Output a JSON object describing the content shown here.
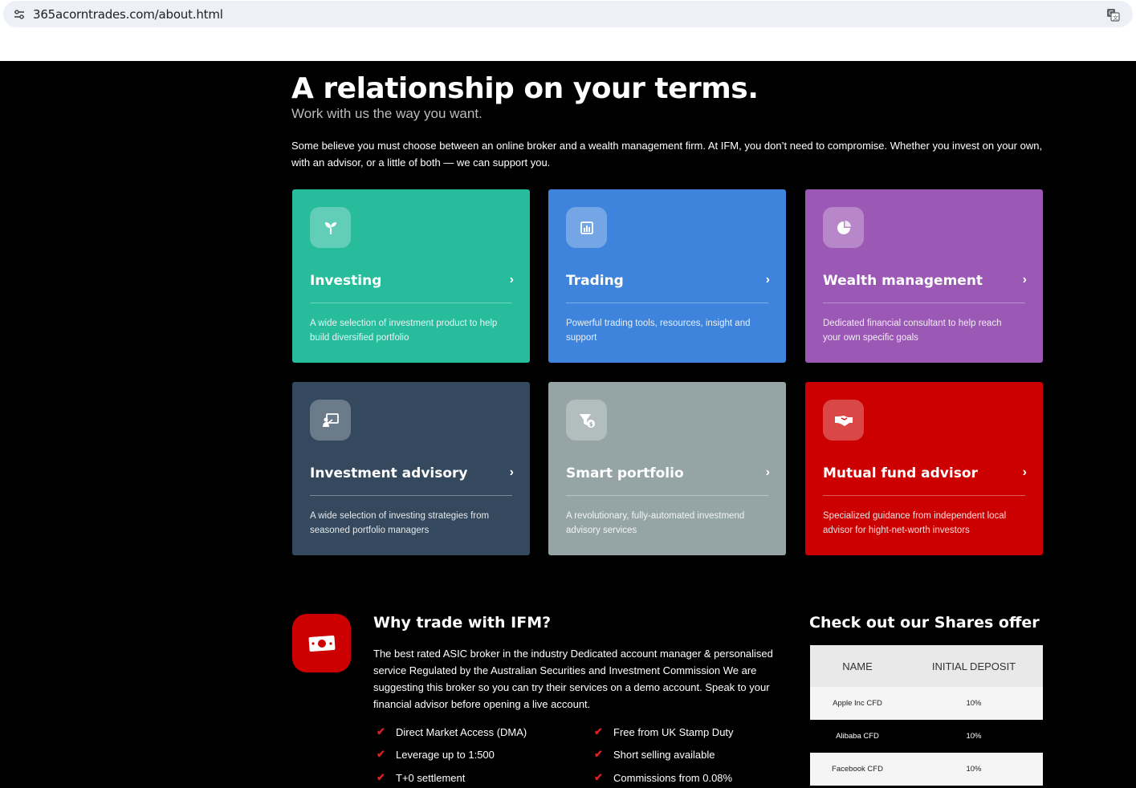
{
  "browser": {
    "url": "365acorntrades.com/about.html"
  },
  "hero": {
    "title_pre": "A",
    "title_highlight": "relationship",
    "title_post": "on your terms.",
    "subtitle": "Work with us the way you want.",
    "body": "Some believe you must choose between an online broker and a wealth management firm. At IFM, you don’t need to compromise. Whether you invest on your own, with an advisor, or a little of both — we can support you."
  },
  "cards": [
    {
      "title": "Investing",
      "desc": "A wide selection of investment product to help build diversified portfolio",
      "color": "#27bc9c",
      "icon": "sprout-icon"
    },
    {
      "title": "Trading",
      "desc": "Powerful trading tools, resources, insight and support",
      "color": "#3f84dc",
      "icon": "bar-chart-icon"
    },
    {
      "title": "Wealth management",
      "desc": "Dedicated financial consultant to help reach your own specific goals",
      "color": "#9b59b5",
      "icon": "pie-chart-icon"
    },
    {
      "title": "Investment advisory",
      "desc": "A wide selection of investing strategies from seasoned portfolio managers",
      "color": "#34495e",
      "icon": "presentation-icon"
    },
    {
      "title": "Smart portfolio",
      "desc": "A revolutionary, fully-automated investmend advisory services",
      "color": "#95a5a5",
      "icon": "funnel-dollar-icon"
    },
    {
      "title": "Mutual fund advisor",
      "desc": "Specialized guidance from independent local advisor for hight-net-worth investors",
      "color": "#cc0000",
      "icon": "handshake-icon"
    }
  ],
  "why": {
    "title": "Why trade with IFM?",
    "body": "The best rated ASIC broker in the industry Dedicated account manager & personalised service Regulated by the Australian Securities and Investment Commission We are suggesting this broker so you can try their services on a demo account. Speak to your financial advisor before opening a live account.",
    "features": [
      "Direct Market Access (DMA)",
      "Free from UK Stamp Duty",
      "Leverage up to 1:500",
      "Short selling available",
      "T+0 settlement",
      "Commissions from 0.08%"
    ]
  },
  "shares": {
    "title": "Check out our Shares offer",
    "headers": [
      "NAME",
      "INITIAL DEPOSIT"
    ],
    "rows": [
      {
        "name": "Apple Inc CFD",
        "deposit": "10%"
      },
      {
        "name": "Alibaba CFD",
        "deposit": "10%"
      },
      {
        "name": "Facebook CFD",
        "deposit": "10%"
      }
    ]
  }
}
